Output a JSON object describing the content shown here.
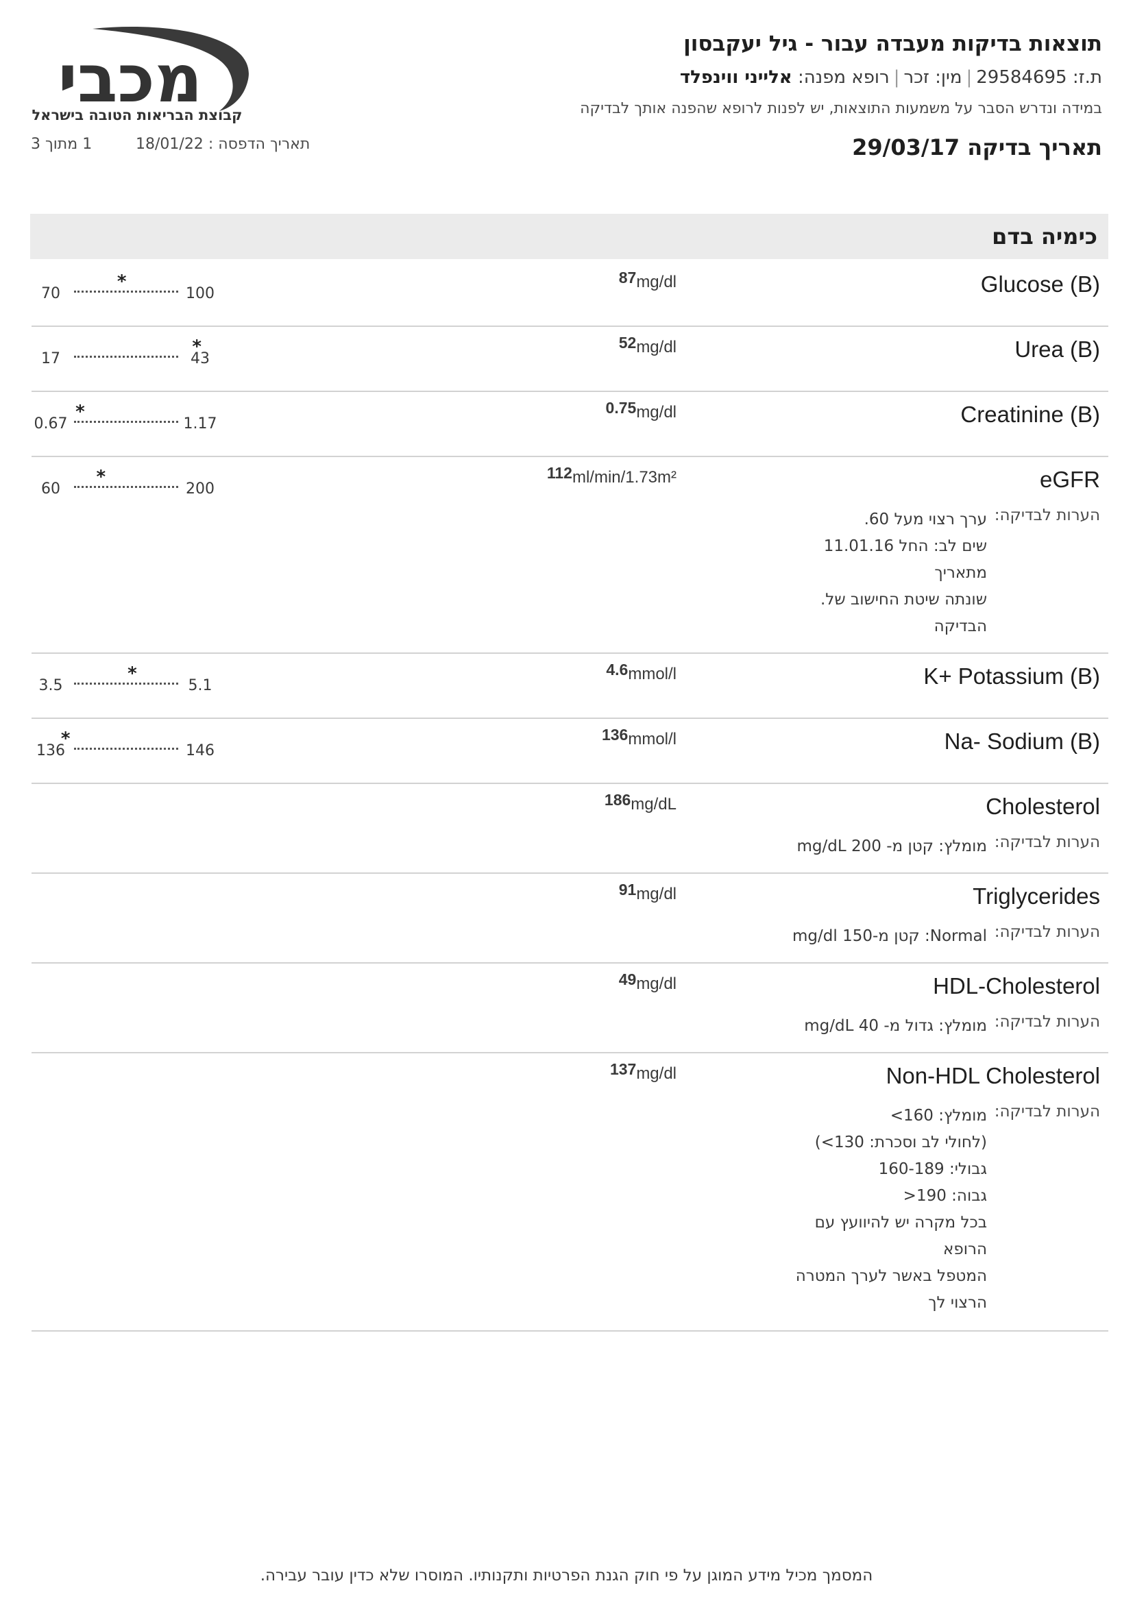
{
  "header": {
    "title": "תוצאות בדיקות מעבדה עבור - גיל יעקבסון",
    "id_label": "ת.ז:",
    "id_value": "29584695",
    "gender_label": "מין:",
    "gender_value": "זכר",
    "doctor_label": "רופא מפנה:",
    "doctor_value": "אלייני ווינפלד",
    "disclaimer": "במידה ונדרש הסבר על משמעות התוצאות, יש לפנות לרופא שהפנה אותך לבדיקה",
    "test_date_label": "תאריך בדיקה",
    "test_date_value": "29/03/17",
    "print_date_label": "תאריך הדפסה :",
    "print_date_value": "18/01/22",
    "page": "1 מתוך 3"
  },
  "logo": {
    "wordmark": "מכבי",
    "tagline": "קבוצת הבריאות הטובה בישראל",
    "color": "#333333"
  },
  "section": {
    "title": "כימיה בדם"
  },
  "notes_label": "הערות לבדיקה:",
  "tests": [
    {
      "name": "Glucose (B)",
      "value": "87",
      "unit": "mg/dl",
      "low": "70",
      "high": "100",
      "position": 0.46,
      "notes": []
    },
    {
      "name": "Urea (B)",
      "value": "52",
      "unit": "mg/dl",
      "low": "17",
      "high": "43",
      "position": 1.18,
      "notes": []
    },
    {
      "name": "Creatinine (B)",
      "value": "0.75",
      "unit": "mg/dl",
      "low": "0.67",
      "high": "1.17",
      "position": 0.06,
      "notes": []
    },
    {
      "name": "eGFR",
      "value": "112",
      "unit": "ml/min/1.73m²",
      "low": "60",
      "high": "200",
      "position": 0.26,
      "notes": [
        "ערך רצוי מעל 60.",
        "שים לב: החל 11.01.16",
        "מתאריך",
        "שונתה שיטת החישוב של.",
        "הבדיקה"
      ]
    },
    {
      "name": "K+ Potassium (B)",
      "value": "4.6",
      "unit": "mmol/l",
      "low": "3.5",
      "high": "5.1",
      "position": 0.56,
      "notes": []
    },
    {
      "name": "Na- Sodium (B)",
      "value": "136",
      "unit": "mmol/l",
      "low": "136",
      "high": "146",
      "position": -0.08,
      "notes": []
    },
    {
      "name": "Cholesterol",
      "value": "186",
      "unit": "mg/dL",
      "low": "",
      "high": "",
      "position": null,
      "notes": [
        "מומלץ: קטן מ- 200 mg/dL"
      ]
    },
    {
      "name": "Triglycerides",
      "value": "91",
      "unit": "mg/dl",
      "low": "",
      "high": "",
      "position": null,
      "notes": [
        "Normal: קטן מ-150 mg/dl"
      ]
    },
    {
      "name": "HDL-Cholesterol",
      "value": "49",
      "unit": "mg/dl",
      "low": "",
      "high": "",
      "position": null,
      "notes": [
        "מומלץ: גדול מ- 40 mg/dL"
      ]
    },
    {
      "name": "Non-HDL Cholesterol",
      "value": "137",
      "unit": "mg/dl",
      "low": "",
      "high": "",
      "position": null,
      "notes": [
        "מומלץ: 160>",
        "(לחולי לב וסכרת: 130>)",
        "גבולי: 160-189",
        "גבוה: 190<",
        "בכל מקרה יש להיוועץ עם",
        "הרופא",
        "המטפל באשר לערך המטרה",
        "הרצוי לך"
      ]
    }
  ],
  "footer": "המסמך מכיל מידע המוגן על פי חוק הגנת הפרטיות ותקנותיו. המוסרו שלא כדין עובר עבירה."
}
